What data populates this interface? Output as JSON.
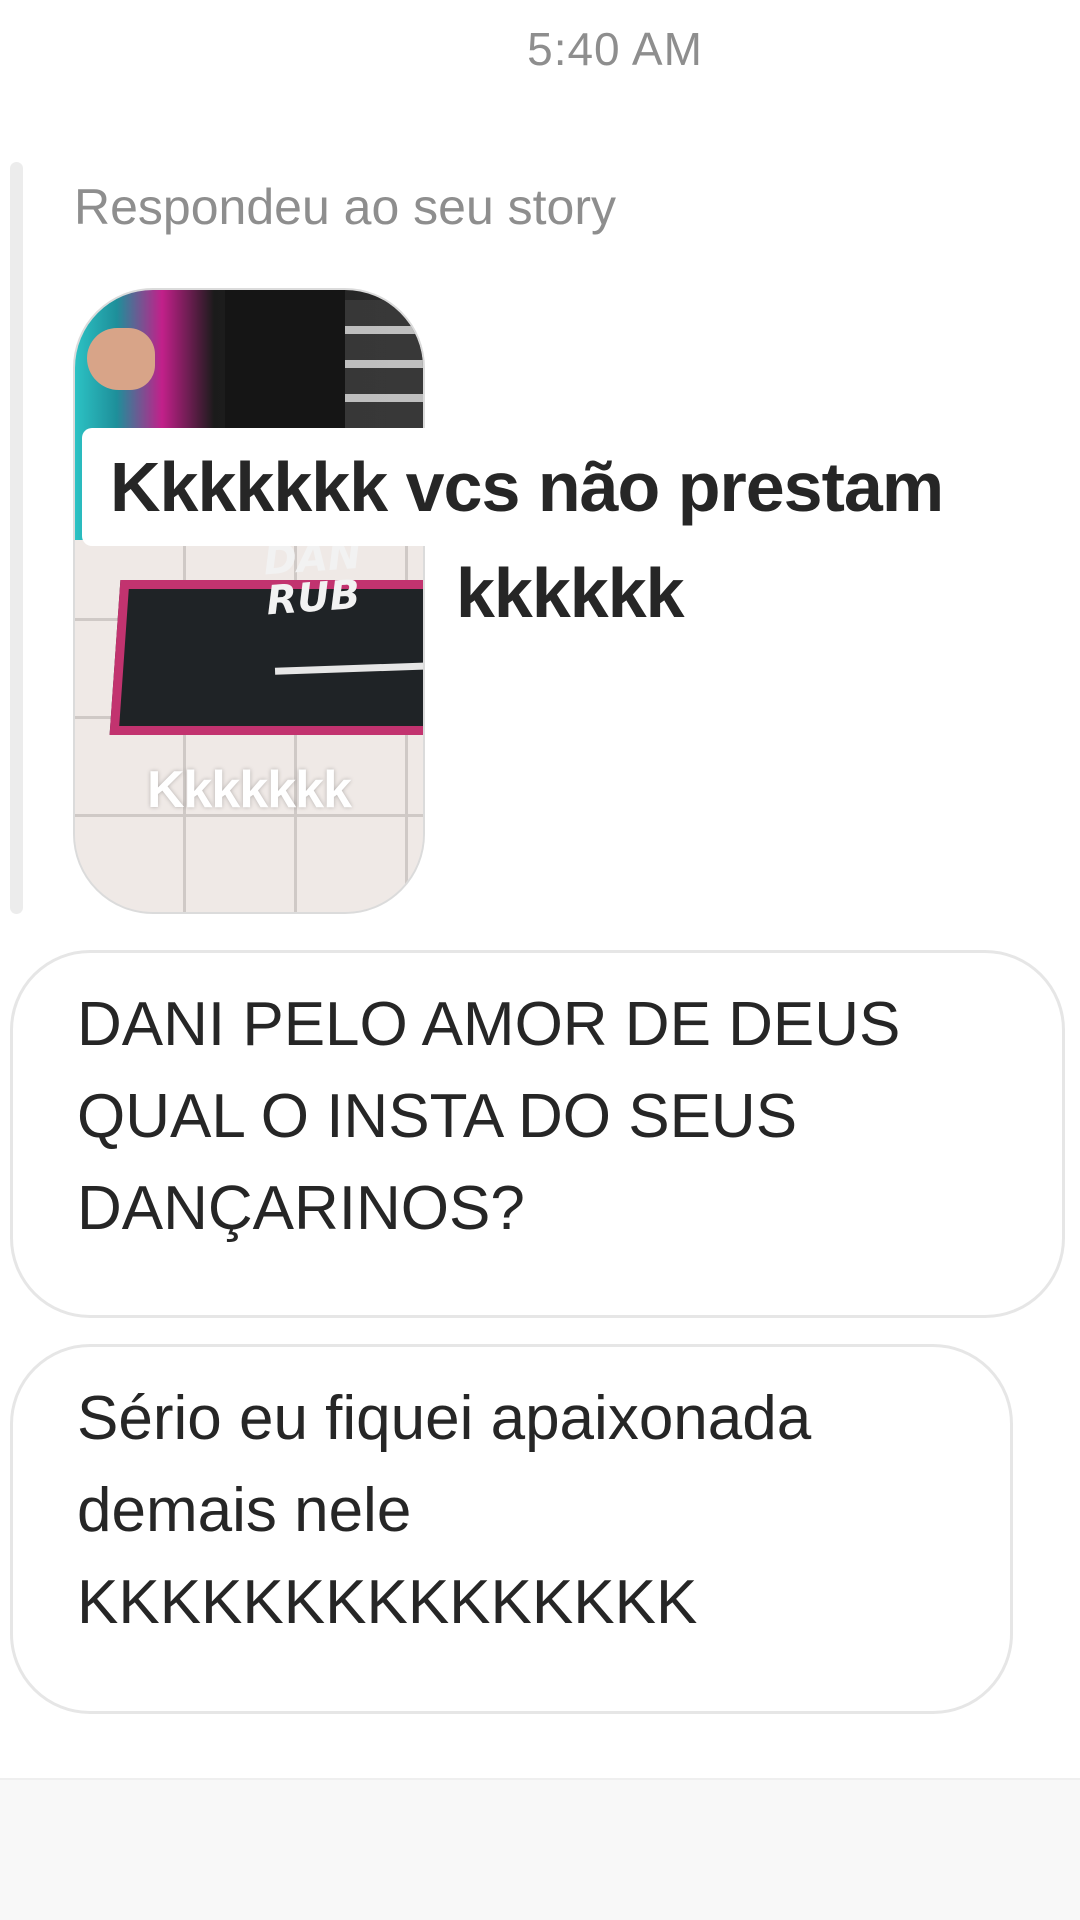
{
  "header": {
    "timestamp": "5:40 AM"
  },
  "story_reply": {
    "caption": "Respondeu ao seu story",
    "thumbnail_overlay_text": "Kkkkkkk",
    "thumbnail_mat_text": "DANI RUBIN",
    "reply_line_1": "Kkkkkkk vcs não prestam",
    "reply_line_2": "kkkkkk"
  },
  "messages": [
    {
      "lines": [
        "DANI PELO AMOR DE DEUS",
        "QUAL O INSTA DO SEUS",
        "DANÇARINOS?"
      ]
    },
    {
      "lines": [
        "Sério eu fiquei apaixonada",
        "demais nele",
        "KKKKKKKKKKKKKKK"
      ]
    }
  ],
  "colors": {
    "text": "#262626",
    "muted": "#8e8e8e",
    "bubble_border": "#e6e6e6",
    "reply_bar": "#ececec",
    "mat_border": "#c2336f"
  }
}
